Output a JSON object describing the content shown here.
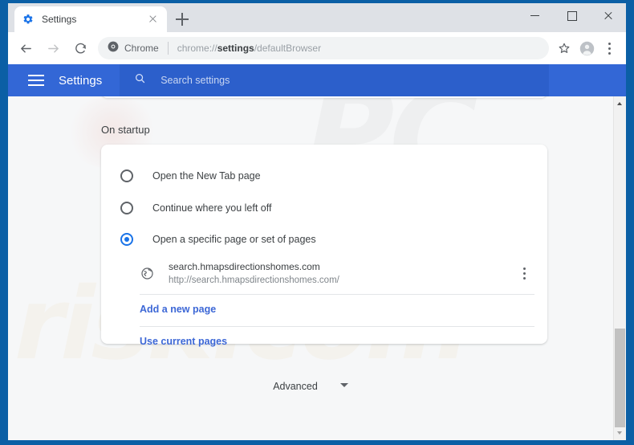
{
  "browser": {
    "tab": {
      "title": "Settings",
      "favicon_icon": "gear-icon",
      "close_icon": "close-icon"
    },
    "new_tab_icon": "plus-icon",
    "window_controls": {
      "minimize_icon": "minimize-icon",
      "maximize_icon": "maximize-icon",
      "close_icon": "close-icon"
    },
    "toolbar": {
      "back_icon": "arrow-left-icon",
      "forward_icon": "arrow-right-icon",
      "reload_icon": "reload-icon",
      "chrome_badge_label": "Chrome",
      "chrome_badge_icon": "chrome-logo-icon",
      "url_prefix": "chrome://",
      "url_bold": "settings",
      "url_suffix": "/defaultBrowser",
      "bookmark_icon": "star-icon",
      "profile_icon": "avatar-icon",
      "menu_icon": "three-dots-vertical-icon"
    }
  },
  "settings_header": {
    "menu_icon": "hamburger-icon",
    "title": "Settings",
    "search_icon": "search-icon",
    "search_placeholder": "Search settings"
  },
  "main": {
    "section_title": "On startup",
    "startup_options": [
      {
        "label": "Open the New Tab page",
        "selected": false
      },
      {
        "label": "Continue where you left off",
        "selected": false
      },
      {
        "label": "Open a specific page or set of pages",
        "selected": true
      }
    ],
    "startup_page": {
      "favicon_icon": "globe-icon",
      "name": "search.hmapsdirectionshomes.com",
      "url": "http://search.hmapsdirectionshomes.com/",
      "menu_icon": "three-dots-vertical-icon"
    },
    "links": {
      "add_page": "Add a new page",
      "use_current": "Use current pages"
    },
    "advanced": {
      "label": "Advanced",
      "chevron_icon": "chevron-down-icon"
    }
  },
  "watermark": {
    "top_text": "PC",
    "bottom_text": "risk.com"
  },
  "scrollbar": {
    "up_icon": "triangle-up-icon",
    "down_icon": "triangle-down-icon"
  },
  "colors": {
    "header_blue": "#3367d6",
    "accent_blue": "#1a73e8",
    "link_blue": "#3c67d6",
    "frame_blue": "#0b5fa5"
  }
}
